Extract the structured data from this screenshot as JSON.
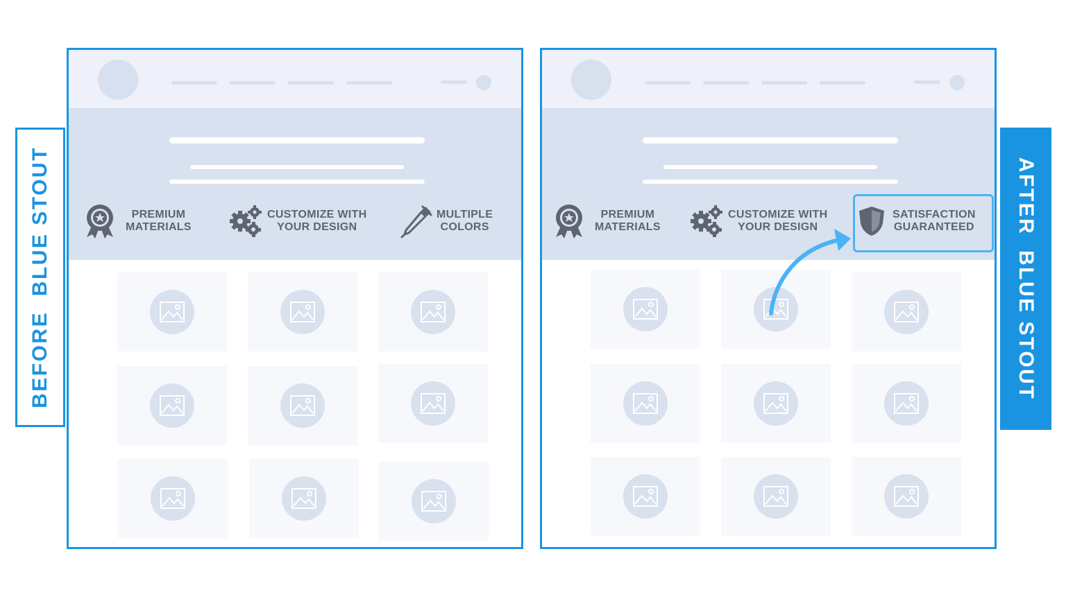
{
  "labels": {
    "before": "BEFORE  BLUE STOUT",
    "after": "AFTER  BLUE STOUT"
  },
  "before": {
    "features": [
      {
        "icon": "ribbon-award-icon",
        "line1": "PREMIUM",
        "line2": "MATERIALS"
      },
      {
        "icon": "gears-icon",
        "line1": "CUSTOMIZE WITH",
        "line2": "YOUR DESIGN"
      },
      {
        "icon": "eyedropper-icon",
        "line1": "MULTIPLE",
        "line2": "COLORS"
      }
    ]
  },
  "after": {
    "features": [
      {
        "icon": "ribbon-award-icon",
        "line1": "PREMIUM",
        "line2": "MATERIALS"
      },
      {
        "icon": "gears-icon",
        "line1": "CUSTOMIZE WITH",
        "line2": "YOUR DESIGN"
      },
      {
        "icon": "shield-icon",
        "line1": "SATISFACTION",
        "line2": "GUARANTEED"
      }
    ]
  },
  "colors": {
    "accent": "#1a94e0",
    "highlight": "#4ab3f5",
    "hero_bg": "#d8e1ef",
    "topbar_bg": "#eef1f9",
    "placeholder": "#d9e0ee",
    "feature_text": "#5e6470"
  }
}
